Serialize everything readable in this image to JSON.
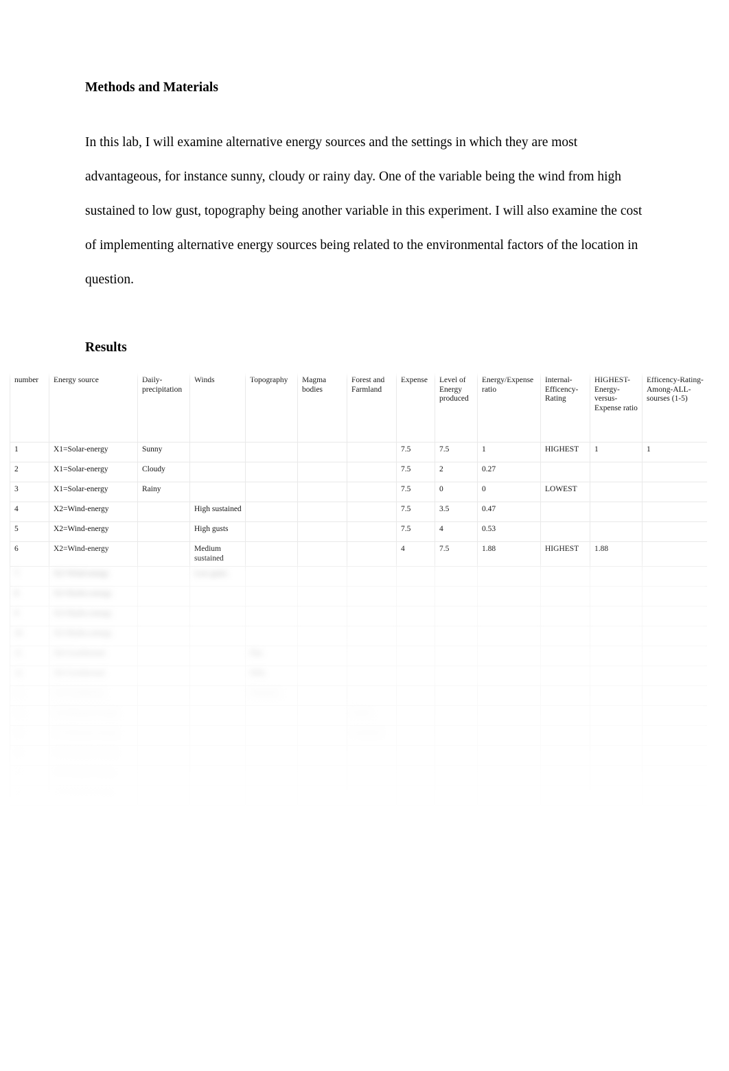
{
  "document": {
    "section_heading": "Methods and Materials",
    "paragraph": "In this lab, I will examine alternative energy sources and the settings in which they are most advantageous, for instance sunny, cloudy or rainy day. One of the variable being the wind from high sustained to low gust, topography being another variable in this experiment. I will also examine the cost of implementing alternative energy sources being related to the environmental factors of the location in question.",
    "results_heading": "Results"
  },
  "results_table": {
    "headers": [
      "number",
      "Energy source",
      "Daily-precipitation",
      "Winds",
      "Topography",
      "Magma bodies",
      "Forest and Farmland",
      "Expense",
      "Level of Energy produced",
      "Energy/Expense ratio",
      "Internal-Efficency-Rating",
      "HIGHEST-Energy-versus-Expense ratio",
      "Efficency-Rating-Among-ALL-sourses (1-5)"
    ],
    "rows": [
      [
        "1",
        "X1=Solar-energy",
        "Sunny",
        "",
        "",
        "",
        "",
        "7.5",
        "7.5",
        "1",
        "HIGHEST",
        "1",
        "1"
      ],
      [
        "2",
        "X1=Solar-energy",
        "Cloudy",
        "",
        "",
        "",
        "",
        "7.5",
        "2",
        "0.27",
        "",
        "",
        ""
      ],
      [
        "3",
        "X1=Solar-energy",
        "Rainy",
        "",
        "",
        "",
        "",
        "7.5",
        "0",
        "0",
        "LOWEST",
        "",
        ""
      ],
      [
        "4",
        "X2=Wind-energy",
        "",
        "High sustained",
        "",
        "",
        "",
        "7.5",
        "3.5",
        "0.47",
        "",
        "",
        ""
      ],
      [
        "5",
        "X2=Wind-energy",
        "",
        "High gusts",
        "",
        "",
        "",
        "7.5",
        "4",
        "0.53",
        "",
        "",
        ""
      ],
      [
        "6",
        "X2=Wind-energy",
        "",
        "Medium sustained",
        "",
        "",
        "",
        "4",
        "7.5",
        "1.88",
        "HIGHEST",
        "1.88",
        ""
      ]
    ],
    "obscured_rows": [
      [
        "7",
        "X2=Wind-energy",
        "",
        "Low gusts",
        "",
        "",
        "",
        "",
        "",
        "",
        "",
        "",
        ""
      ],
      [
        "8",
        "X3=Hydro-energy",
        "",
        "",
        "",
        "",
        "",
        "",
        "",
        "",
        "",
        "",
        ""
      ],
      [
        "9",
        "X3=Hydro-energy",
        "",
        "",
        "",
        "",
        "",
        "",
        "",
        "",
        "",
        "",
        ""
      ],
      [
        "10",
        "X3=Hydro-energy",
        "",
        "",
        "",
        "",
        "",
        "",
        "",
        "",
        "",
        "",
        ""
      ],
      [
        "11",
        "X4=Geothermal",
        "",
        "",
        "Flat",
        "",
        "",
        "",
        "",
        "",
        "",
        "",
        ""
      ],
      [
        "12",
        "X4=Geothermal",
        "",
        "",
        "Hills",
        "",
        "",
        "",
        "",
        "",
        "",
        "",
        ""
      ],
      [
        "13",
        "X4=Geothermal",
        "",
        "",
        "Mountain",
        "",
        "",
        "",
        "",
        "",
        "",
        "",
        ""
      ],
      [
        "14",
        "X5=Biomass-energy",
        "",
        "",
        "",
        "",
        "Forest",
        "",
        "",
        "",
        "",
        "",
        ""
      ],
      [
        "15",
        "X5=Biomass-energy",
        "",
        "",
        "",
        "",
        "Farmland",
        "",
        "",
        "",
        "",
        "",
        ""
      ],
      [
        "16",
        "X5=Biomass-energy",
        "",
        "",
        "",
        "",
        "",
        "",
        "",
        "",
        "",
        "",
        ""
      ],
      [
        "17",
        "X6=Nuclear-energy",
        "",
        "",
        "",
        "",
        "",
        "",
        "",
        "",
        "",
        "",
        ""
      ],
      [
        "18",
        "X6=Nuclear-energy",
        "",
        "",
        "",
        "",
        "",
        "",
        "",
        "",
        "",
        "",
        ""
      ]
    ]
  }
}
